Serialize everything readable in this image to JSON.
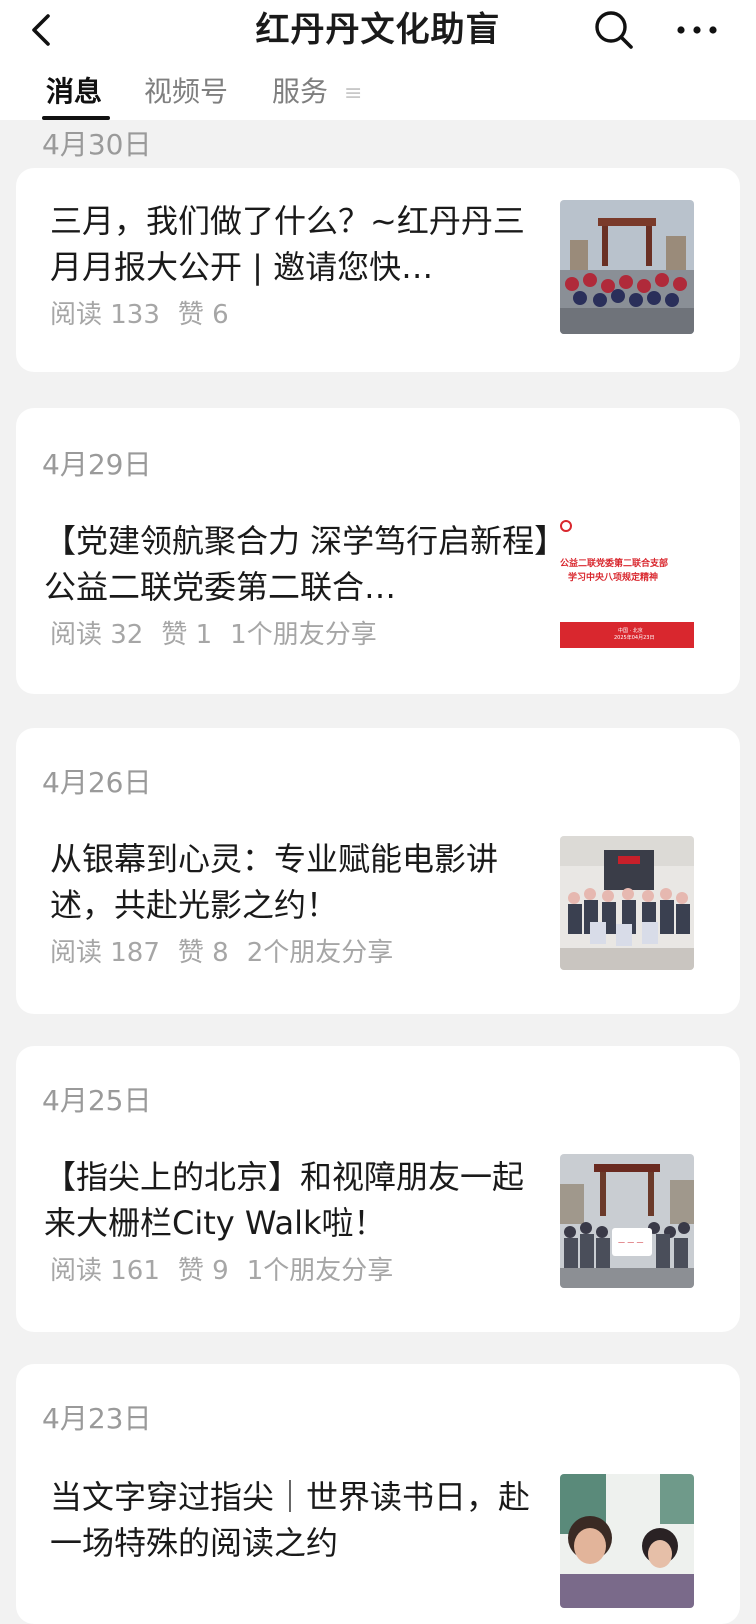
{
  "header": {
    "title": "红丹丹文化助盲",
    "back_icon": "chevron-left-icon",
    "search_icon": "search-icon",
    "more_icon": "more-horizontal-icon"
  },
  "tabs": [
    {
      "label": "消息",
      "active": true
    },
    {
      "label": "视频号",
      "active": false
    },
    {
      "label": "服务",
      "active": false
    }
  ],
  "tab_more_glyph": "≡",
  "articles": [
    {
      "date": "4月30日",
      "title": "三月，我们做了什么？~红丹丹三月月报大公开 | 邀请您快…",
      "reads": "阅读 133",
      "likes": "赞 6",
      "shares": ""
    },
    {
      "date": "4月29日",
      "title": "【党建领航聚合力 深学笃行启新程】公益二联党委第二联合…",
      "reads": "阅读 32",
      "likes": "赞 1",
      "shares": "1个朋友分享",
      "thumb_text": {
        "line1": "公益二联党委第二联合支部",
        "line2": "学习中央八项规定精神",
        "line3": "中国 · 北京",
        "line4": "2025年04月23日"
      }
    },
    {
      "date": "4月26日",
      "title": "从银幕到心灵：专业赋能电影讲述，共赴光影之约！",
      "reads": "阅读 187",
      "likes": "赞 8",
      "shares": "2个朋友分享"
    },
    {
      "date": "4月25日",
      "title": "【指尖上的北京】和视障朋友一起来大栅栏City Walk啦！",
      "reads": "阅读 161",
      "likes": "赞 9",
      "shares": "1个朋友分享"
    },
    {
      "date": "4月23日",
      "title": "当文字穿过指尖｜世界读书日，赴一场特殊的阅读之约",
      "reads": "",
      "likes": "",
      "shares": ""
    }
  ]
}
